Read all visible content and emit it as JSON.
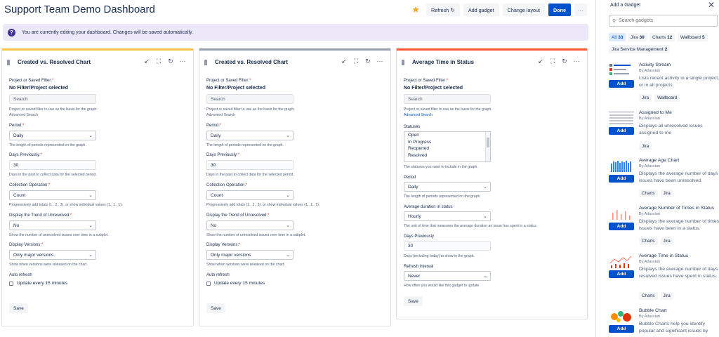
{
  "header": {
    "title": "Support Team Demo Dashboard",
    "refresh_label": "Refresh",
    "add_gadget_label": "Add gadget",
    "change_layout_label": "Change layout",
    "done_label": "Done",
    "more_label": "···"
  },
  "banner": {
    "text": "You are currently editing your dashboard. Changes will be saved automatically."
  },
  "gadgets": [
    {
      "title": "Created vs. Resolved Chart",
      "border_color": "#f6c342",
      "filter_label": "Project or Saved Filter:",
      "filter_value": "No Filter/Project selected",
      "search_placeholder": "Search",
      "filter_help": "Project or saved filter to use as the basis for the graph.",
      "advanced_search": "Advanced Search",
      "period_label": "Period:",
      "period_value": "Daily",
      "period_help": "The length of periods represented on the graph.",
      "days_label": "Days Previously:",
      "days_value": "30",
      "days_help": "Days in the past to collect data for the selected period.",
      "op_label": "Collection Operation:",
      "op_value": "Count",
      "op_help": "Progressively add totals (1.. 2.. 3), or show individual values (1.. 1.. 1).",
      "trend_label": "Display the Trend of Unresolved:",
      "trend_value": "No",
      "trend_help": "Show the number of unresolved issues over time in a subplot.",
      "versions_label": "Display Versions:",
      "versions_value": "Only major versions",
      "versions_help": "Show when versions were released on the chart.",
      "auto_label": "Auto refresh",
      "auto_cb_label": "Update every 15 minutes",
      "save_label": "Save"
    },
    {
      "title": "Created vs. Resolved Chart",
      "border_color": "#97a0af",
      "filter_label": "Project or Saved Filter:",
      "filter_value": "No Filter/Project selected",
      "search_placeholder": "Search",
      "filter_help": "Project or saved filter to use as the basis for the graph.",
      "advanced_search": "Advanced Search",
      "period_label": "Period:",
      "period_value": "Daily",
      "period_help": "The length of periods represented on the graph.",
      "days_label": "Days Previously:",
      "days_value": "30",
      "days_help": "Days in the past to collect data for the selected period.",
      "op_label": "Collection Operation:",
      "op_value": "Count",
      "op_help": "Progressively add totals (1.. 2.. 3), or show individual values (1.. 1.. 1).",
      "trend_label": "Display the Trend of Unresolved:",
      "trend_value": "No",
      "trend_help": "Show the number of unresolved issues over time in a subplot.",
      "versions_label": "Display Versions:",
      "versions_value": "Only major versions",
      "versions_help": "Show when versions were released on the chart.",
      "auto_label": "Auto refresh",
      "auto_cb_label": "Update every 15 minutes",
      "save_label": "Save"
    },
    {
      "title": "Average Time in Status",
      "border_color": "#ff5630",
      "filter_label": "Project or Saved Filter:",
      "filter_value": "No Filter/Project selected",
      "search_placeholder": "Search",
      "filter_help": "Project or saved filter to use as the basis for the graph.",
      "advanced_search": "Advanced Search",
      "statuses_label": "Statuses",
      "statuses": [
        "Open",
        "In Progress",
        "Reopened",
        "Resolved"
      ],
      "statuses_help": "The statuses you want to include in the graph.",
      "period_label": "Period",
      "period_value": "Daily",
      "period_help": "The length of periods represented on the graph.",
      "duration_label": "Average duration in status",
      "duration_value": "Hourly",
      "duration_help": "The unit of time that measures the average duration an issue has spent in a status",
      "days_label": "Days Previously",
      "days_value": "30",
      "days_help": "Days (including today) to show in the graph.",
      "refresh_label": "Refresh Interval",
      "refresh_value": "Never",
      "refresh_help": "How often you would like this gadget to update",
      "save_label": "Save"
    }
  ],
  "sidebar": {
    "title": "Add a Gadget",
    "search_placeholder": "Search gadgets",
    "chips": [
      {
        "label": "All",
        "count": "33",
        "active": true
      },
      {
        "label": "Jira",
        "count": "30",
        "active": false
      },
      {
        "label": "Charts",
        "count": "12",
        "active": false
      },
      {
        "label": "Wallboard",
        "count": "5",
        "active": false
      },
      {
        "label": "Jira Service Management",
        "count": "2",
        "active": false
      }
    ],
    "add_label": "Add",
    "items": [
      {
        "name": "Activity Stream",
        "by": "By Atlassian",
        "desc": "Lists recent activity in a single project, or in all projects.",
        "tags": [
          "Jira",
          "Wallboard"
        ]
      },
      {
        "name": "Assigned to Me",
        "by": "By Atlassian",
        "desc": "Displays all unresolved issues assigned to me",
        "tags": [
          "Jira"
        ]
      },
      {
        "name": "Average Age Chart",
        "by": "By Atlassian",
        "desc": "Displays the average number of days issues have been unresolved.",
        "tags": [
          "Charts",
          "Jira"
        ]
      },
      {
        "name": "Average Number of Times in Status",
        "by": "By Atlassian",
        "desc": "Displays the average number of times issues have been in a status.",
        "tags": [
          "Charts",
          "Jira"
        ]
      },
      {
        "name": "Average Time in Status",
        "by": "By Atlassian",
        "desc": "Displays the average number of days resolved issues have spent in status.",
        "tags": [
          "Charts",
          "Jira"
        ]
      },
      {
        "name": "Bubble Chart",
        "by": "By Atlassian",
        "desc": "Bubble Charts help you identify popular and significant issues by",
        "tags": []
      }
    ]
  }
}
